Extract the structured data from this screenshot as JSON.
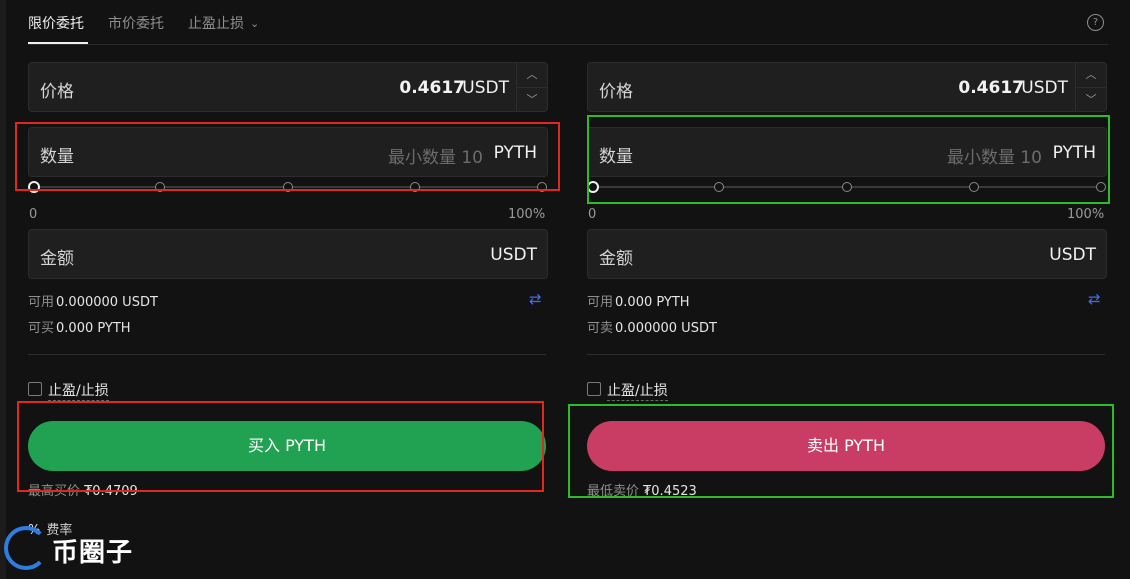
{
  "tabs": [
    {
      "label": "限价委托",
      "active": true
    },
    {
      "label": "市价委托",
      "active": false
    },
    {
      "label": "止盈止损",
      "active": false
    }
  ],
  "help_icon": "question-circle-icon",
  "buy": {
    "price_label": "价格",
    "price_value": "0.4617",
    "price_unit": "USDT",
    "qty_label": "数量",
    "qty_placeholder": "最小数量 10",
    "qty_unit": "PYTH",
    "slider_min": "0",
    "slider_max": "100%",
    "slider_value_percent": 0,
    "amount_label": "金额",
    "amount_unit": "USDT",
    "available_label": "可用",
    "available_value": "0.000000 USDT",
    "can_buy_label": "可买",
    "can_buy_value": "0.000 PYTH",
    "tpsl_label": "止盈/止损",
    "button_label": "买入 PYTH",
    "best_label": "最高买价",
    "best_value": "₮0.4709"
  },
  "sell": {
    "price_label": "价格",
    "price_value": "0.4617",
    "price_unit": "USDT",
    "qty_label": "数量",
    "qty_placeholder": "最小数量 10",
    "qty_unit": "PYTH",
    "slider_min": "0",
    "slider_max": "100%",
    "slider_value_percent": 0,
    "amount_label": "金额",
    "amount_unit": "USDT",
    "available_label": "可用",
    "available_value": "0.000 PYTH",
    "can_sell_label": "可卖",
    "can_sell_value": "0.000000 USDT",
    "tpsl_label": "止盈/止损",
    "button_label": "卖出 PYTH",
    "best_label": "最低卖价",
    "best_value": "₮0.4523"
  },
  "fee": {
    "icon": "%",
    "label": "费率"
  },
  "watermark": {
    "text": "币圈子"
  },
  "colors": {
    "buy": "#21a152",
    "sell": "#c93d64",
    "highlight_red": "#e0281f",
    "highlight_green": "#2bbb2b",
    "swap_icon": "#3d6cf5"
  }
}
